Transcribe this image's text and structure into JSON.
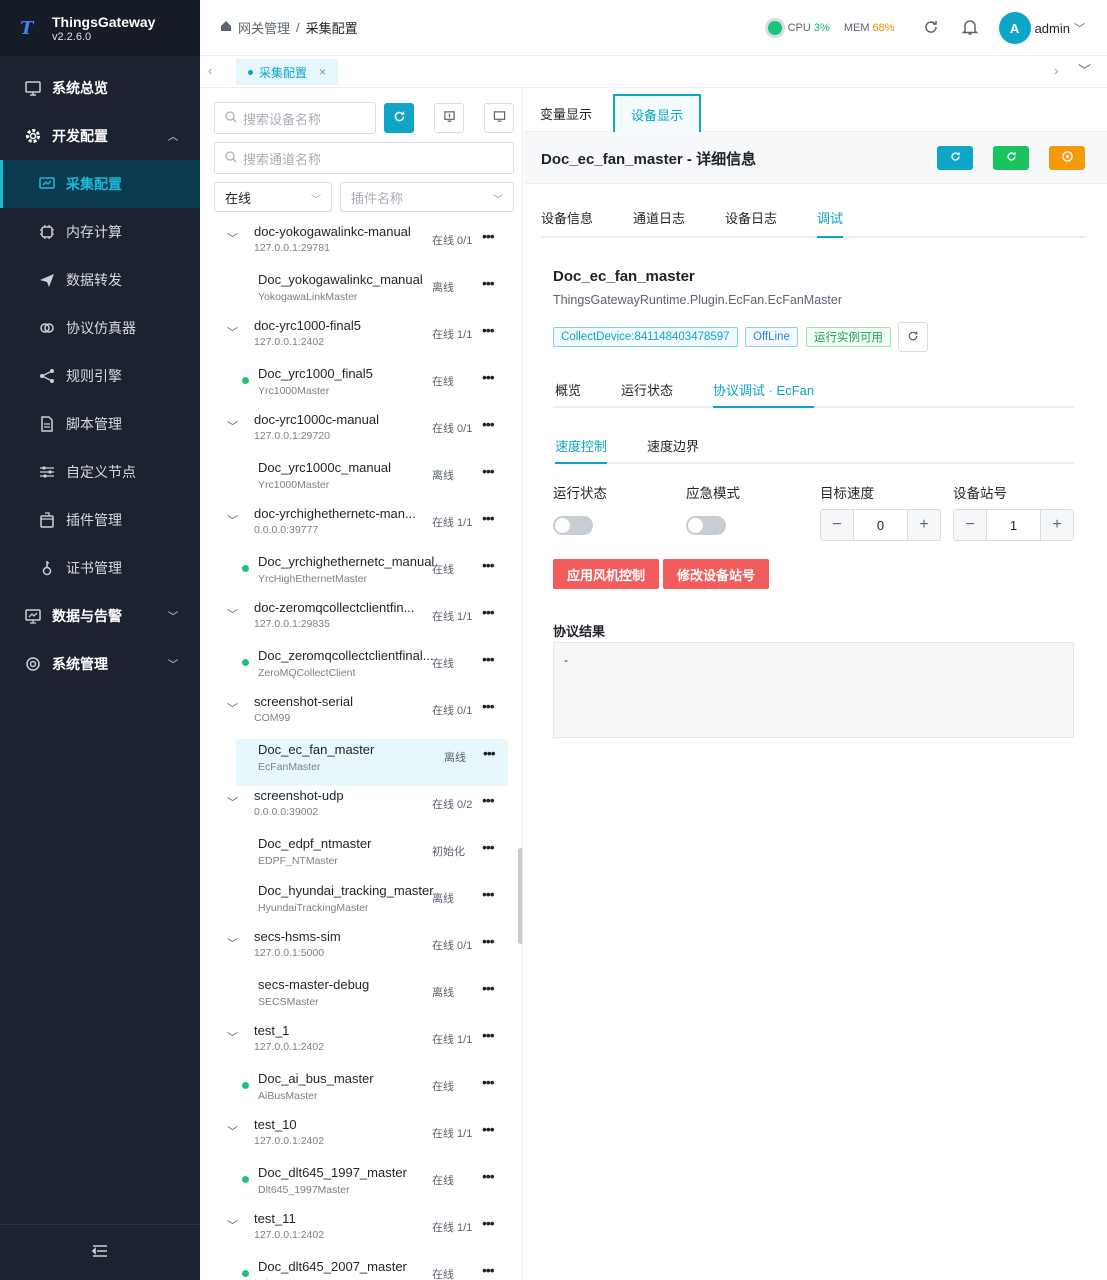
{
  "app": {
    "name": "ThingsGateway",
    "version": "v2.2.6.0",
    "logo_letter": "T"
  },
  "sidebar": {
    "items": [
      {
        "label": "系统总览",
        "icon": "monitor-icon"
      },
      {
        "label": "开发配置",
        "icon": "gear-icon"
      },
      {
        "label": "采集配置",
        "icon": "chart-icon"
      },
      {
        "label": "内存计算",
        "icon": "chip-icon"
      },
      {
        "label": "数据转发",
        "icon": "send-icon"
      },
      {
        "label": "协议仿真器",
        "icon": "link-icon"
      },
      {
        "label": "规则引擎",
        "icon": "share-icon"
      },
      {
        "label": "脚本管理",
        "icon": "file-icon"
      },
      {
        "label": "自定义节点",
        "icon": "sliders-icon"
      },
      {
        "label": "插件管理",
        "icon": "box-icon"
      },
      {
        "label": "证书管理",
        "icon": "key-icon"
      },
      {
        "label": "数据与告警",
        "icon": "board-icon"
      },
      {
        "label": "系统管理",
        "icon": "cog-icon"
      }
    ]
  },
  "header": {
    "breadcrumb": [
      "网关管理",
      "采集配置"
    ],
    "cpu_label": "CPU",
    "cpu_value": "3%",
    "mem_label": "MEM",
    "mem_value": "68%",
    "user": "admin",
    "avatar_letter": "A"
  },
  "tabs": {
    "active": "采集配置"
  },
  "left": {
    "search_device_placeholder": "搜索设备名称",
    "search_channel_placeholder": "搜索通道名称",
    "status_filter": "在线",
    "plugin_placeholder": "插件名称",
    "tree": [
      {
        "kind": "group",
        "name": "doc-yokogawalinkc-manual",
        "addr": "127.0.0.1:29781",
        "status": "在线 0/1"
      },
      {
        "kind": "device",
        "name": "Doc_yokogawalinkc_manual",
        "plugin": "YokogawaLinkMaster",
        "status": "离线",
        "online": false
      },
      {
        "kind": "group",
        "name": "doc-yrc1000-final5",
        "addr": "127.0.0.1:2402",
        "status": "在线 1/1"
      },
      {
        "kind": "device",
        "name": "Doc_yrc1000_final5",
        "plugin": "Yrc1000Master",
        "status": "在线",
        "online": true
      },
      {
        "kind": "group",
        "name": "doc-yrc1000c-manual",
        "addr": "127.0.0.1:29720",
        "status": "在线 0/1"
      },
      {
        "kind": "device",
        "name": "Doc_yrc1000c_manual",
        "plugin": "Yrc1000Master",
        "status": "离线",
        "online": false
      },
      {
        "kind": "group",
        "name": "doc-yrchighethernetc-man...",
        "addr": "0.0.0.0:39777",
        "status": "在线 1/1"
      },
      {
        "kind": "device",
        "name": "Doc_yrchighethernetc_manual",
        "plugin": "YrcHighEthernetMaster",
        "status": "在线",
        "online": true
      },
      {
        "kind": "group",
        "name": "doc-zeromqcollectclientfin...",
        "addr": "127.0.0.1:29835",
        "status": "在线 1/1"
      },
      {
        "kind": "device",
        "name": "Doc_zeromqcollectclientfinal...",
        "plugin": "ZeroMQCollectClient",
        "status": "在线",
        "online": true
      },
      {
        "kind": "group",
        "name": "screenshot-serial",
        "addr": "COM99",
        "status": "在线 0/1"
      },
      {
        "kind": "device",
        "name": "Doc_ec_fan_master",
        "plugin": "EcFanMaster",
        "status": "离线",
        "online": false,
        "selected": true
      },
      {
        "kind": "group",
        "name": "screenshot-udp",
        "addr": "0.0.0.0:39002",
        "status": "在线 0/2"
      },
      {
        "kind": "device",
        "name": "Doc_edpf_ntmaster",
        "plugin": "EDPF_NTMaster",
        "status": "初始化",
        "online": false
      },
      {
        "kind": "device",
        "name": "Doc_hyundai_tracking_master",
        "plugin": "HyundaiTrackingMaster",
        "status": "离线",
        "online": false
      },
      {
        "kind": "group",
        "name": "secs-hsms-sim",
        "addr": "127.0.0.1:5000",
        "status": "在线 0/1"
      },
      {
        "kind": "device",
        "name": "secs-master-debug",
        "plugin": "SECSMaster",
        "status": "离线",
        "online": false
      },
      {
        "kind": "group",
        "name": "test_1",
        "addr": "127.0.0.1:2402",
        "status": "在线 1/1"
      },
      {
        "kind": "device",
        "name": "Doc_ai_bus_master",
        "plugin": "AiBusMaster",
        "status": "在线",
        "online": true
      },
      {
        "kind": "group",
        "name": "test_10",
        "addr": "127.0.0.1:2402",
        "status": "在线 1/1"
      },
      {
        "kind": "device",
        "name": "Doc_dlt645_1997_master",
        "plugin": "Dlt645_1997Master",
        "status": "在线",
        "online": true
      },
      {
        "kind": "group",
        "name": "test_11",
        "addr": "127.0.0.1:2402",
        "status": "在线 1/1"
      },
      {
        "kind": "device",
        "name": "Doc_dlt645_2007_master",
        "plugin": "Dlt645_2007Master",
        "status": "在线",
        "online": true
      }
    ]
  },
  "right": {
    "view_tabs": [
      "变量显示",
      "设备显示"
    ],
    "title": "Doc_ec_fan_master - 详细信息",
    "detail_tabs": [
      "设备信息",
      "通道日志",
      "设备日志",
      "调试"
    ],
    "device_name": "Doc_ec_fan_master",
    "device_class": "ThingsGatewayRuntime.Plugin.EcFan.EcFanMaster",
    "badges": [
      "CollectDevice:841148403478597",
      "OffLine",
      "运行实例可用"
    ],
    "proto_tabs": [
      "概览",
      "运行状态",
      "协议调试 · EcFan"
    ],
    "sub_tabs": [
      "速度控制",
      "速度边界"
    ],
    "fields": {
      "run_state": "运行状态",
      "emergency": "应急模式",
      "target_speed": "目标速度",
      "station": "设备站号"
    },
    "target_speed_value": "0",
    "station_value": "1",
    "apply_button": "应用风机控制",
    "modify_button": "修改设备站号",
    "result_label": "协议结果",
    "result_value": "-"
  }
}
